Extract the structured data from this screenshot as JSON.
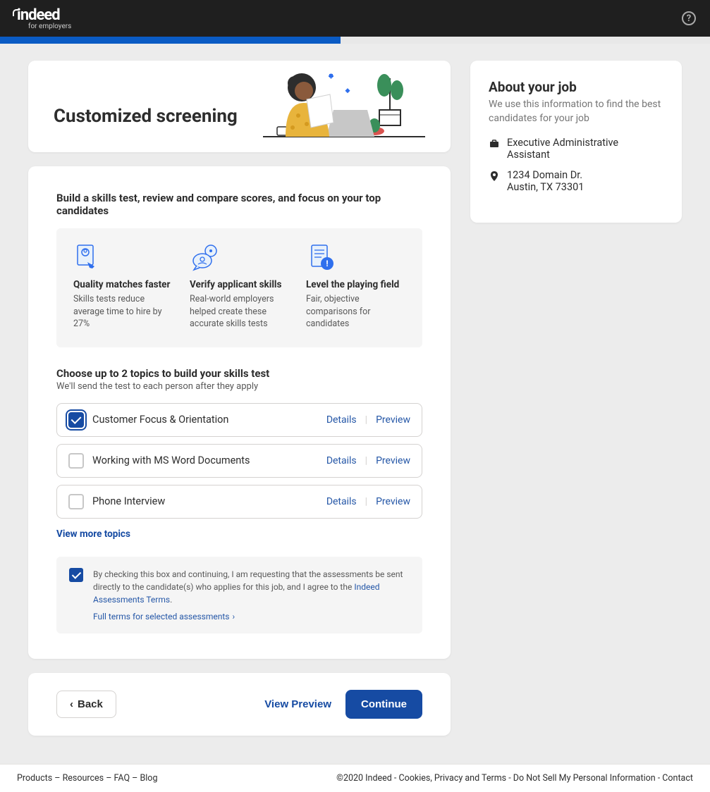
{
  "header": {
    "logo_main": "indeed",
    "logo_sub": "for employers"
  },
  "hero": {
    "title": "Customized screening"
  },
  "main": {
    "build_heading": "Build a skills test, review and compare scores, and focus on your top candidates",
    "benefits": [
      {
        "title": "Quality matches faster",
        "body": "Skills tests reduce average time to hire by 27%"
      },
      {
        "title": "Verify applicant skills",
        "body": "Real-world employers helped create these accurate skills tests"
      },
      {
        "title": "Level the playing field",
        "body": "Fair, objective comparisons for candidates"
      }
    ],
    "choose_heading": "Choose up to 2 topics to build your skills test",
    "choose_sub": "We'll send the test to each person after they apply",
    "topics": [
      {
        "label": "Customer Focus & Orientation",
        "checked": true
      },
      {
        "label": "Working with MS Word Documents",
        "checked": false
      },
      {
        "label": "Phone Interview",
        "checked": false
      }
    ],
    "details_label": "Details",
    "preview_label": "Preview",
    "more_link": "View more topics",
    "consent_text_prefix": "By checking this box and continuing, I am requesting that the assessments be sent directly to the candidate(s) who applies for this job, and I agree to the ",
    "consent_link": "Indeed Assessments Terms",
    "terms_link": "Full terms for selected assessments"
  },
  "nav": {
    "back": "Back",
    "view_preview": "View Preview",
    "continue": "Continue"
  },
  "sidebar": {
    "title": "About your job",
    "desc": "We use this information to find the best candidates for your job",
    "job_title": "Executive Administrative Assistant",
    "address_line1": "1234 Domain Dr.",
    "address_line2": "Austin, TX 73301"
  },
  "footer": {
    "left": {
      "products": "Products",
      "resources": "Resources",
      "faq": "FAQ",
      "blog": "Blog"
    },
    "right": {
      "copyright": "©2020 Indeed",
      "cookies": "Cookies, Privacy and Terms",
      "dns": "Do Not Sell My Personal Information",
      "contact": "Contact"
    }
  }
}
